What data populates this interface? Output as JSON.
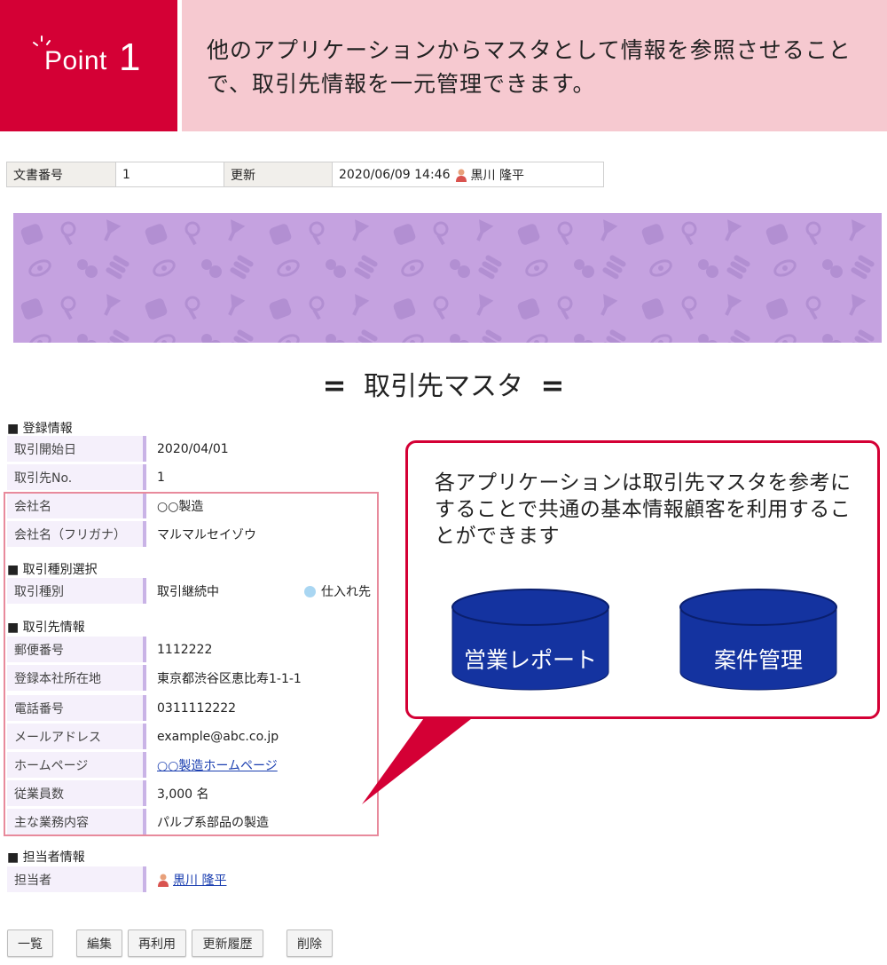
{
  "point": {
    "label": "Point",
    "number": "1",
    "text": "他のアプリケーションからマスタとして情報を参照させることで、取引先情報を一元管理できます。"
  },
  "doc_info": {
    "number_label": "文書番号",
    "number_value": "1",
    "updated_label": "更新",
    "updated_value": "2020/06/09 14:46",
    "updated_user": "黒川 隆平"
  },
  "title": {
    "left_mark": "=",
    "text": "取引先マスタ",
    "right_mark": "="
  },
  "sections": {
    "registration": "■ 登録情報",
    "type_select": "■ 取引種別選択",
    "partner_info": "■ 取引先情報",
    "person": "■ 担当者情報"
  },
  "fields": {
    "start_date": {
      "label": "取引開始日",
      "value": "2020/04/01"
    },
    "partner_no": {
      "label": "取引先No.",
      "value": "1"
    },
    "company": {
      "label": "会社名",
      "value": "○○製造"
    },
    "company_kana": {
      "label": "会社名（フリガナ）",
      "value": "マルマルセイゾウ"
    },
    "trade_type": {
      "label": "取引種別",
      "value": "取引継続中",
      "option": "仕入れ先"
    },
    "postal": {
      "label": "郵便番号",
      "value": "1112222"
    },
    "address": {
      "label": "登録本社所在地",
      "value": "東京都渋谷区恵比寿1-1-1"
    },
    "phone": {
      "label": "電話番号",
      "value": "0311112222"
    },
    "email": {
      "label": "メールアドレス",
      "value": "example@abc.co.jp"
    },
    "homepage": {
      "label": "ホームページ",
      "value": "○○製造ホームページ"
    },
    "employees": {
      "label": "従業員数",
      "value": "3,000 名"
    },
    "business": {
      "label": "主な業務内容",
      "value": "パルプ系部品の製造"
    },
    "person": {
      "label": "担当者",
      "value": "黒川 隆平"
    }
  },
  "callout": {
    "text": "各アプリケーションは取引先マスタを参考にすることで共通の基本情報顧客を利用することができます",
    "apps": [
      "営業レポート",
      "案件管理"
    ]
  },
  "buttons": {
    "list": "一覧",
    "edit": "編集",
    "reuse": "再利用",
    "history": "更新履歴",
    "delete": "削除"
  },
  "colors": {
    "accent_red": "#d40035",
    "point_bg": "#f6c9d0",
    "banner": "#c5a2e0",
    "cylinder": "#1433a0"
  }
}
